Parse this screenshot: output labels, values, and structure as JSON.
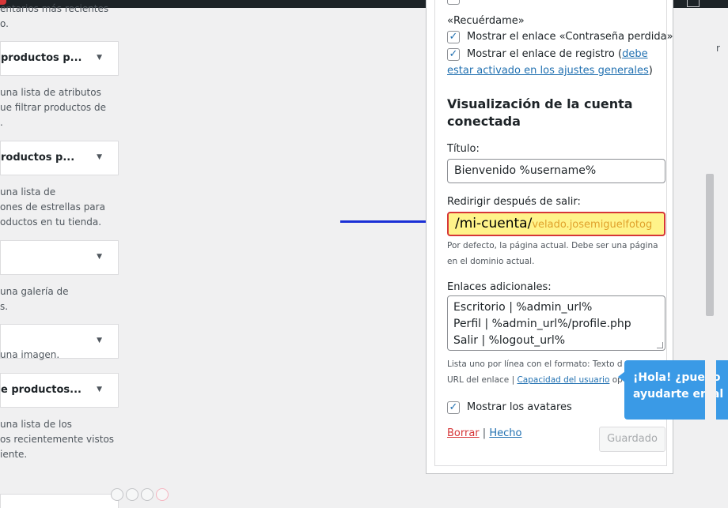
{
  "left": {
    "frag_top": "entarios más recientes",
    "frag_top2": "o.",
    "widgets": [
      {
        "title": "productos p...",
        "desc": [
          "una lista de atributos",
          "ue filtrar productos de",
          "."
        ]
      },
      {
        "title": "roductos p...",
        "desc": [
          "una lista de",
          "ones de estrellas para",
          "oductos en tu tienda."
        ]
      },
      {
        "title": "",
        "desc": [
          "una galería de",
          "s."
        ]
      },
      {
        "title": "",
        "desc": [
          "una imagen."
        ]
      },
      {
        "title": "e productos...",
        "desc": [
          "una lista de los",
          "os recientemente vistos",
          "iente."
        ]
      }
    ]
  },
  "form": {
    "remember": "«Recuérdame»",
    "show_lost_password": "Mostrar el enlace «Contraseña perdida»",
    "show_register_prefix": "Mostrar el enlace de registro (",
    "show_register_link": "debe estar activado en los ajustes generales",
    "show_register_link_1": "debe",
    "show_register_link_2": "estar activado en los ajustes generales",
    "show_register_suffix": ")",
    "section_title": "Visualización de la cuenta conectada",
    "title_label": "Título:",
    "title_value": "Bienvenido %username%",
    "redirect_label": "Redirigir después de salir:",
    "redirect_value": "/mi-cuenta/",
    "redirect_ghost": "velado.josemiguelfotog",
    "redirect_help": "Por defecto, la página actual. Debe ser una página en el dominio actual.",
    "links_label": "Enlaces adicionales:",
    "links_lines": [
      "Escritorio | %admin_url%",
      "Perfil | %admin_url%/profile.php",
      "Salir | %logout_url%"
    ],
    "links_help_1": "Lista uno por línea con el formato: Texto d",
    "links_help_2": "URL del enlace | ",
    "links_help_link": "Capacidad del usuario",
    "links_help_3": " op",
    "show_avatars": "Mostrar los avatares",
    "delete": "Borrar",
    "separator": "|",
    "done": "Hecho",
    "save": "Guardado"
  },
  "chat": {
    "line1": "¡Hola! ¿puedo",
    "line2": "ayudarte en al"
  },
  "edge_char": "r",
  "colors": {
    "link": "#2271b1",
    "delete": "#d63638",
    "arrow": "#1a2fd6",
    "chat": "#3a9ae6"
  }
}
